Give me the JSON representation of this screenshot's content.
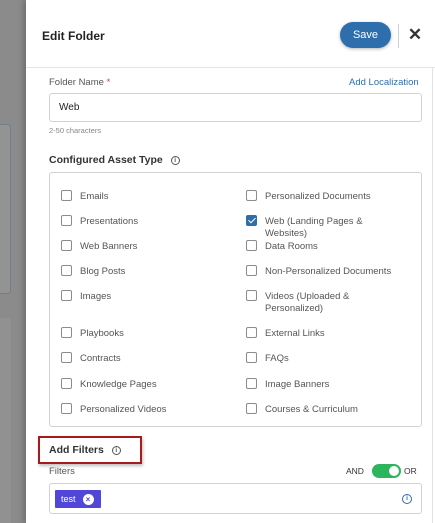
{
  "header": {
    "title": "Edit Folder",
    "save_label": "Save",
    "close_glyph": "✕"
  },
  "folder_name": {
    "label": "Folder Name",
    "required_mark": "*",
    "localization_link": "Add Localization",
    "value": "Web",
    "hint": "2-50 characters"
  },
  "asset_type": {
    "title": "Configured Asset Type",
    "info_glyph": "i",
    "items": [
      {
        "label": "Emails",
        "checked": false
      },
      {
        "label": "Personalized Documents",
        "checked": false
      },
      {
        "label": "Presentations",
        "checked": false
      },
      {
        "label": "Web (Landing Pages & Websites)",
        "checked": true
      },
      {
        "label": "Web Banners",
        "checked": false
      },
      {
        "label": "Data Rooms",
        "checked": false
      },
      {
        "label": "Blog Posts",
        "checked": false
      },
      {
        "label": "Non-Personalized Documents",
        "checked": false
      },
      {
        "label": "Images",
        "checked": false
      },
      {
        "label": "Videos (Uploaded & Personalized)",
        "checked": false
      },
      {
        "label": "Playbooks",
        "checked": false
      },
      {
        "label": "External Links",
        "checked": false
      },
      {
        "label": "Contracts",
        "checked": false
      },
      {
        "label": "FAQs",
        "checked": false
      },
      {
        "label": "Knowledge Pages",
        "checked": false
      },
      {
        "label": "Image Banners",
        "checked": false
      },
      {
        "label": "Personalized Videos",
        "checked": false
      },
      {
        "label": "Courses & Curriculum",
        "checked": false
      }
    ]
  },
  "filters": {
    "title": "Add Filters",
    "info_glyph": "i",
    "field_label": "Filters",
    "and_label": "AND",
    "or_label": "OR",
    "toggle_on": true,
    "chips": [
      {
        "label": "test",
        "remove_glyph": "×"
      }
    ],
    "field_info_glyph": "i"
  },
  "colors": {
    "accent": "#2e6ead",
    "chip": "#5047d8",
    "toggle": "#2db55d",
    "highlight": "#a61b1b"
  }
}
